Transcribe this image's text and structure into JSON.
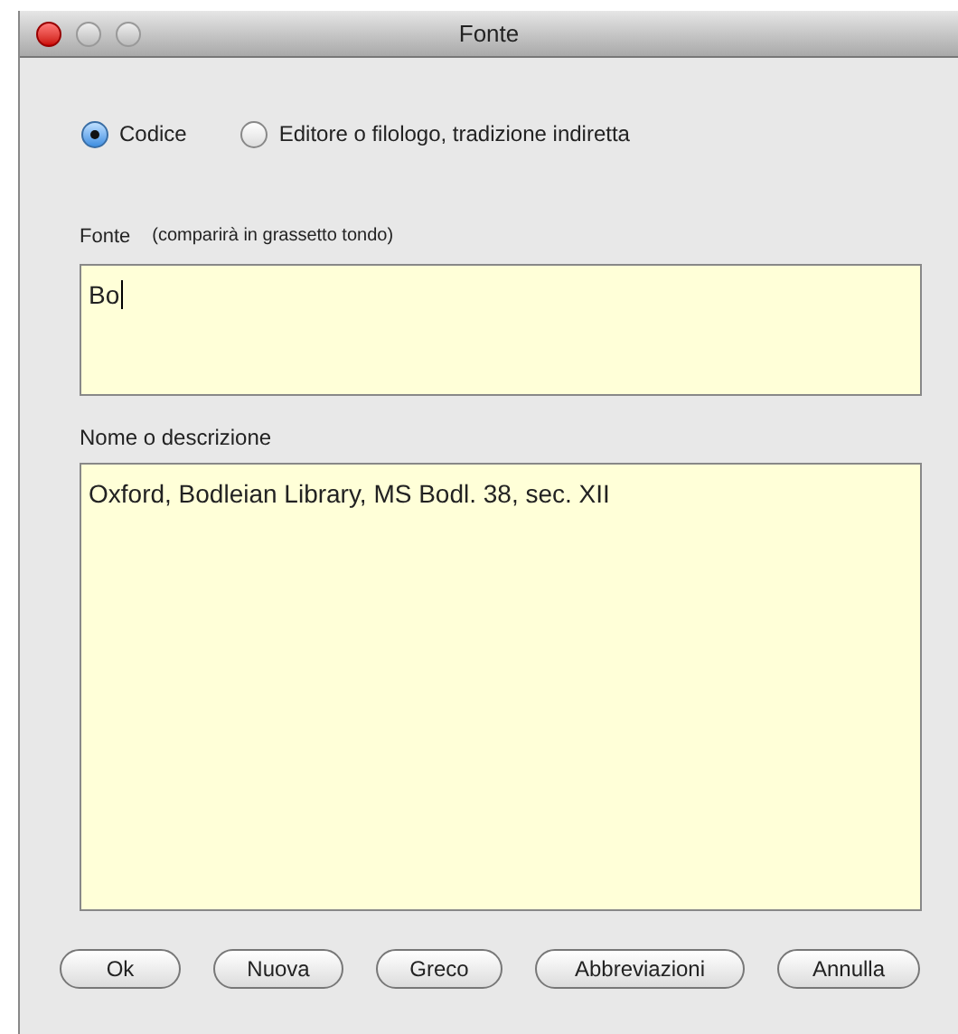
{
  "window": {
    "title": "Fonte"
  },
  "source_type": [
    {
      "label": "Codice",
      "selected": true
    },
    {
      "label": "Editore o filologo, tradizione indiretta",
      "selected": false
    }
  ],
  "source_field": {
    "label": "Fonte",
    "hint": "(comparirà in grassetto tondo)",
    "value": "Bo"
  },
  "description_field": {
    "label": "Nome o descrizione",
    "value": "Oxford, Bodleian Library, MS Bodl. 38, sec. XII"
  },
  "buttons": [
    "Ok",
    "Nuova",
    "Greco",
    "Abbreviazioni",
    "Annulla"
  ]
}
